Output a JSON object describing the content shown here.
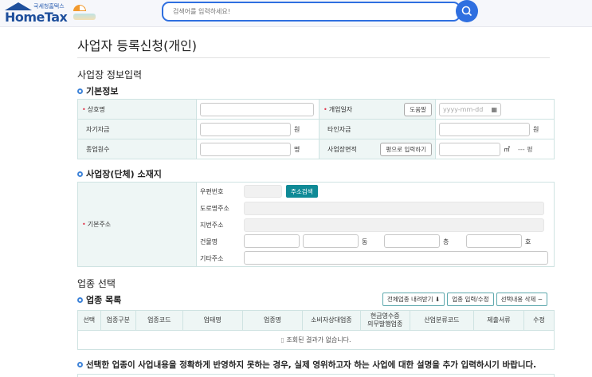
{
  "header": {
    "logo_small": "국세청홈택스",
    "logo_big": "HomeTax",
    "search_placeholder": "검색어를 입력하세요!"
  },
  "page": {
    "title": "사업자 등록신청(개인)",
    "section1": "사업장 정보입력"
  },
  "basic": {
    "heading": "기본정보",
    "trade_name": "상호명",
    "open_date": "개업일자",
    "help": "도움말",
    "date_placeholder": "yyyy-mm-dd",
    "own_funds": "자기자금",
    "won": "원",
    "other_funds": "타인자금",
    "won2": "원",
    "employees": "종업원수",
    "people": "명",
    "area": "사업장면적",
    "pyeong_btn": "평으로 입력하기",
    "sqm": "㎡",
    "pyeong": "--- 평"
  },
  "address": {
    "heading": "사업장(단체) 소재지",
    "label": "기본주소",
    "zip": "우편번호",
    "search_btn": "주소검색",
    "road": "도로명주소",
    "lot": "지번주소",
    "building": "건물명",
    "dong": "동",
    "floor": "층",
    "ho": "호",
    "etc": "기타주소"
  },
  "industry": {
    "heading": "업종 선택",
    "list_heading": "업종 목록",
    "download": "전체업종 내려받기",
    "edit": "업종 입력/수정",
    "delete": "선택내용 삭제",
    "columns": [
      "선택",
      "업종구분",
      "업종코드",
      "업태명",
      "업종명",
      "소비자상대업종",
      "현금영수증\n의무발행업종",
      "산업분류코드",
      "제출서류",
      "수정"
    ],
    "empty": "조회된 결과가 없습니다.",
    "notice": "선택한 업종이 사업내용을 정확하게 반영하지 못하는 경우, 실제 영위하고자 하는 사업에 대한 설명을 추가 입력하시기 바랍니다."
  }
}
